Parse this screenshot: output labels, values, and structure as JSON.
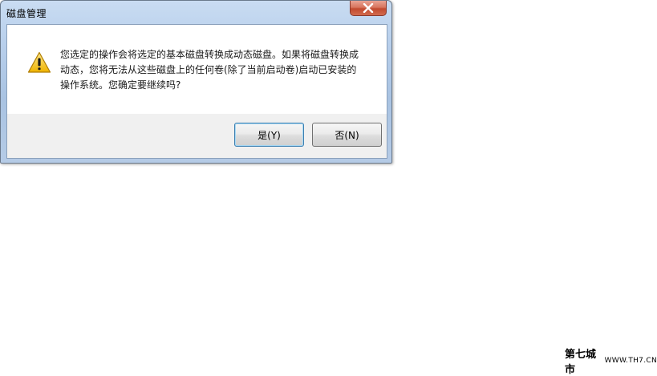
{
  "window": {
    "title": "磁盘管理"
  },
  "message": {
    "icon": "warning-icon",
    "lines": [
      "您选定的操作会将选定的基本磁盘转换成动态磁盘。如果将磁盘转换成",
      "动态，您将无法从这些磁盘上的任何卷(除了当前启动卷)启动已安装的",
      "操作系统。您确定要继续吗?"
    ]
  },
  "buttons": {
    "yes_label": "是(Y)",
    "no_label": "否(N)"
  },
  "watermark": {
    "brand": "第七城市",
    "url": "WWW.TH7.CN"
  },
  "colors": {
    "title_bar": "#b9d0ec",
    "close_button": "#c24a2f",
    "button_area": "#f0f0f0",
    "warning_fill": "#f5c518"
  }
}
